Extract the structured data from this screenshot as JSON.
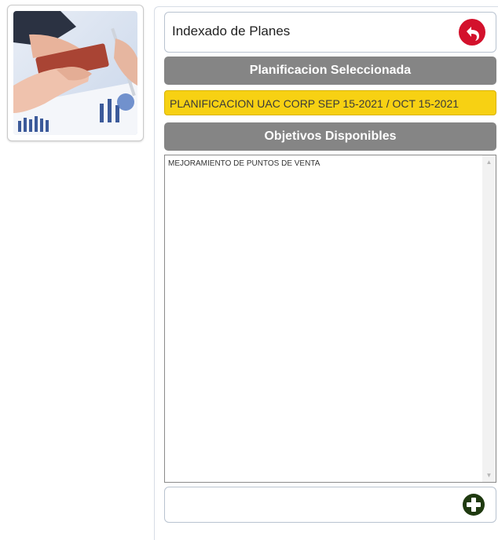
{
  "header": {
    "title": "Indexado de Planes",
    "back_icon": "undo-arrow-icon",
    "back_color": "#d3112c"
  },
  "selected_section": {
    "label": "Planificacion Seleccionada",
    "value": "PLANIFICACION UAC CORP SEP 15-2021 / OCT 15-2021",
    "highlight_color": "#f7d113"
  },
  "objectives_section": {
    "label": "Objetivos Disponibles",
    "items": [
      "MEJORAMIENTO DE PUNTOS DE VENTA"
    ]
  },
  "footer": {
    "add_icon": "plus-circle-icon",
    "add_color": "#1f3a10"
  },
  "thumbnail": {
    "icon": "business-chart-photo"
  }
}
